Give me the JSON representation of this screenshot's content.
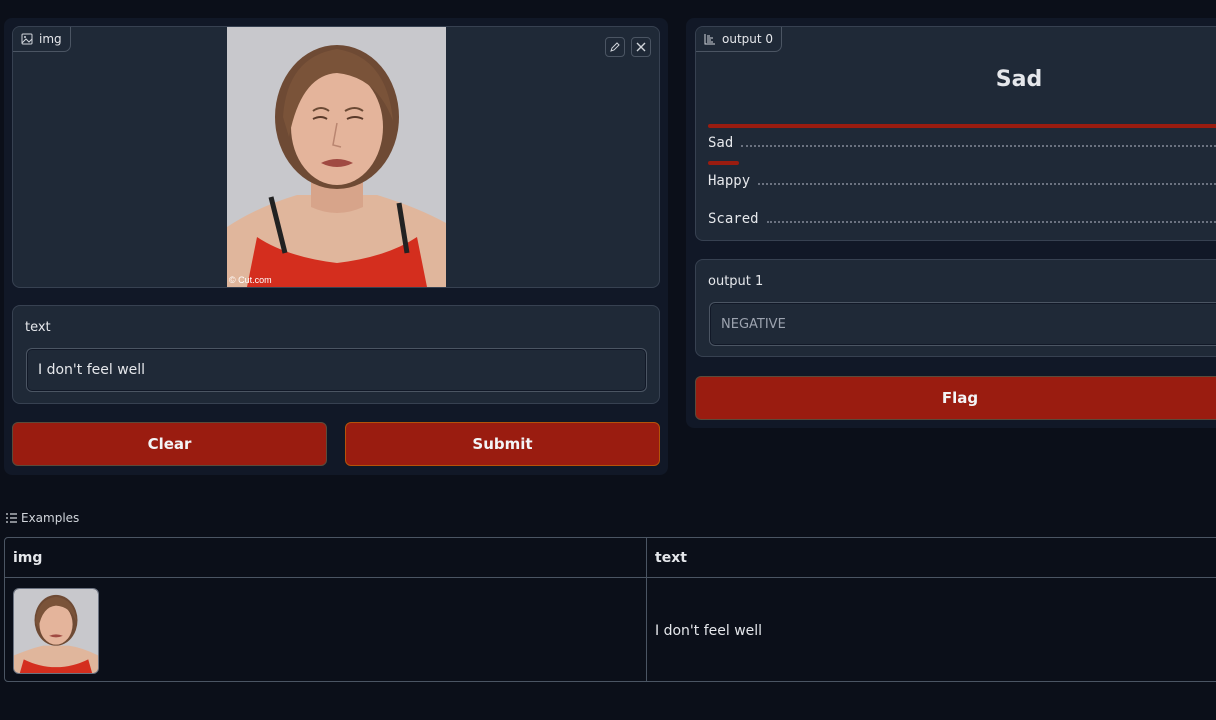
{
  "input_panel": {
    "image_component": {
      "label": "img",
      "watermark": "© Cut.com",
      "edit_icon": "pencil-icon",
      "close_icon": "close-icon"
    },
    "text_component": {
      "label": "text",
      "value": "I don't feel well"
    },
    "buttons": {
      "clear_label": "Clear",
      "submit_label": "Submit"
    }
  },
  "output_panel": {
    "output0": {
      "label": "output 0",
      "top_label": "Sad",
      "confidences": [
        {
          "label": "Sad",
          "value": 1.0
        },
        {
          "label": "Happy",
          "value": 0.06
        },
        {
          "label": "Scared",
          "value": 0.0
        }
      ]
    },
    "output1": {
      "label": "output 1",
      "value": "NEGATIVE"
    },
    "flag_label": "Flag"
  },
  "examples": {
    "title": "Examples",
    "columns": [
      "img",
      "text"
    ],
    "rows": [
      {
        "img": "example-image-thumbnail",
        "text": "I don't feel well"
      }
    ]
  },
  "colors": {
    "background": "#0b0f19",
    "panel": "#1f2937",
    "accent": "#9a1c10",
    "border": "#374151"
  }
}
